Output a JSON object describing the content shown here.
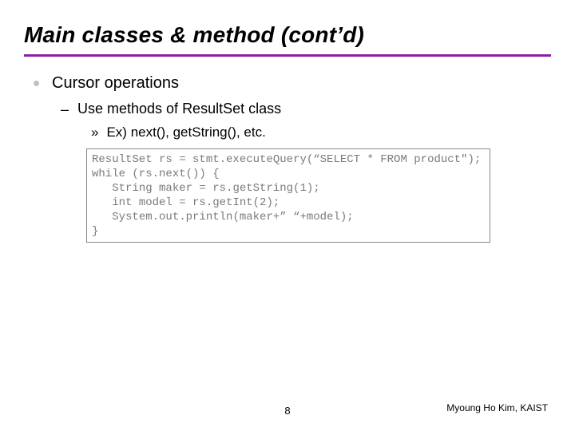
{
  "colors": {
    "accent": "#8b1fa3",
    "code_text": "#7a7a7a"
  },
  "title": "Main classes & method (cont’d)",
  "content": {
    "bullet1": {
      "text": "Cursor operations"
    },
    "bullet2": {
      "marker": "–",
      "text": "Use methods of ResultSet class"
    },
    "bullet3": {
      "marker": "»",
      "text": "Ex) next(), getString(), etc."
    },
    "code": "ResultSet rs = stmt.executeQuery(“SELECT * FROM product\");\nwhile (rs.next()) {\n   String maker = rs.getString(1);\n   int model = rs.getInt(2);\n   System.out.println(maker+” “+model);\n}"
  },
  "footer": {
    "page_number": "8",
    "credit": "Myoung Ho Kim, KAIST"
  }
}
